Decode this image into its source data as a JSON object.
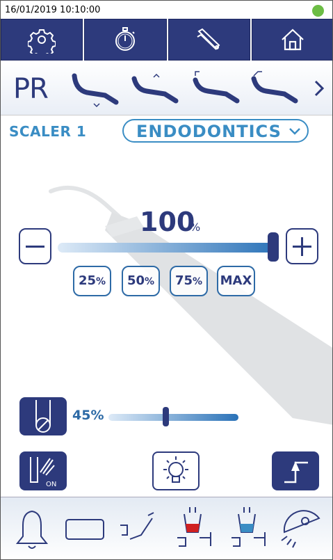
{
  "status_bar": {
    "datetime": "16/01/2019  10:10:00",
    "indicator_color": "#6cbd45"
  },
  "top_nav": {
    "items": [
      {
        "icon": "gear-icon"
      },
      {
        "icon": "stopwatch-icon"
      },
      {
        "icon": "instruments-icon"
      },
      {
        "icon": "home-icon"
      }
    ]
  },
  "chair_row": {
    "program_label": "PR",
    "positions": [
      {
        "icon": "chair-down-icon"
      },
      {
        "icon": "chair-back-up-icon"
      },
      {
        "icon": "chair-position-3-icon"
      },
      {
        "icon": "chair-position-4-icon"
      }
    ],
    "next_icon": "chevron-right-icon"
  },
  "instrument": {
    "label": "SCALER 1",
    "mode": "ENDODONTICS"
  },
  "power": {
    "value": "100",
    "unit": "%",
    "level": 1.0,
    "presets": [
      {
        "num": "25",
        "pct": "%"
      },
      {
        "num": "50",
        "pct": "%"
      },
      {
        "num": "75",
        "pct": "%"
      },
      {
        "num": "MAX",
        "pct": ""
      }
    ]
  },
  "irrigation": {
    "value": "45%",
    "level": 0.45
  },
  "function_buttons": [
    {
      "icon": "spray-on-icon",
      "badge": "ON"
    },
    {
      "icon": "light-icon"
    },
    {
      "icon": "foot-pedal-icon"
    }
  ],
  "bottom_bar": {
    "items": [
      {
        "icon": "bell-icon"
      },
      {
        "icon": "tray-icon"
      },
      {
        "icon": "assistant-chair-icon"
      },
      {
        "icon": "cup-fill-red-icon"
      },
      {
        "icon": "cup-fill-blue-icon"
      },
      {
        "icon": "operating-light-icon"
      }
    ]
  },
  "colors": {
    "navy": "#2d3a7c",
    "accent_blue": "#3a8dc4",
    "status_green": "#6cbd45",
    "red_fill": "#d02020",
    "blue_fill": "#3a8dc4"
  }
}
